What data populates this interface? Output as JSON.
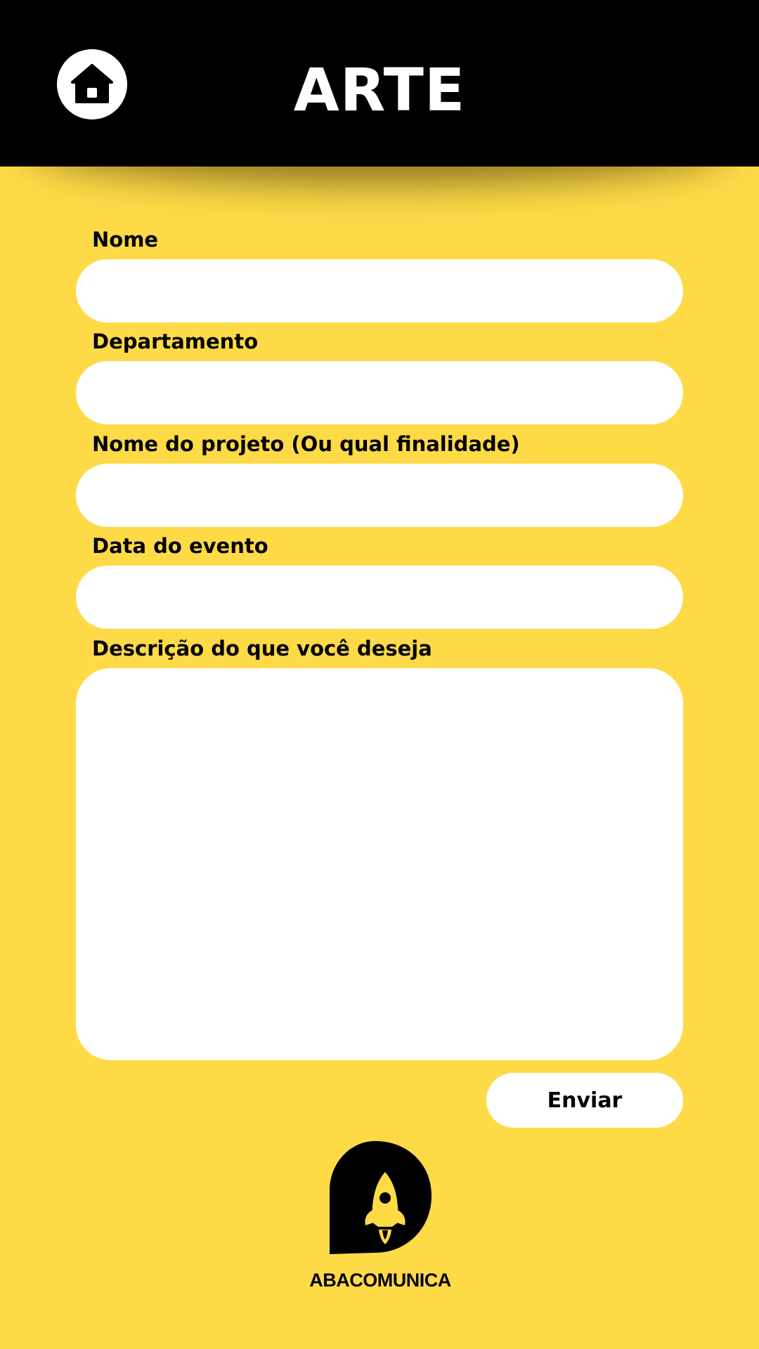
{
  "header": {
    "title": "ARTE",
    "home_icon": "home-icon"
  },
  "form": {
    "fields": [
      {
        "label": "Nome",
        "value": "",
        "placeholder": ""
      },
      {
        "label": "Departamento",
        "value": "",
        "placeholder": ""
      },
      {
        "label": "Nome do projeto (Ou qual finalidade)",
        "value": "",
        "placeholder": ""
      },
      {
        "label": "Data do evento",
        "value": "",
        "placeholder": ""
      },
      {
        "label": "Descrição do que você deseja",
        "value": "",
        "placeholder": ""
      }
    ],
    "submit_label": "Enviar"
  },
  "logo": {
    "text": "ABACOMUNICA",
    "icon": "rocket-icon"
  },
  "colors": {
    "background": "#FFDA47",
    "header": "#000000",
    "field": "#FFFFFF",
    "text": "#000000"
  }
}
